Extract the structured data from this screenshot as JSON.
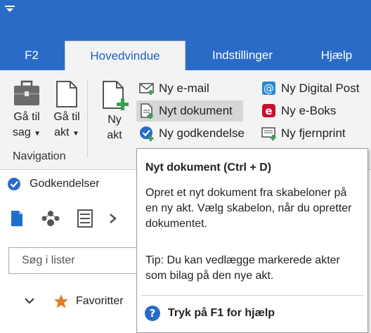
{
  "colors": {
    "accent": "#2a6bc7",
    "ribbon_bg": "#f3f3f3",
    "highlight": "#d6d6d6"
  },
  "tabs": [
    {
      "label": "F2"
    },
    {
      "label": "Hovedvindue"
    },
    {
      "label": "Indstillinger"
    },
    {
      "label": "Hjælp"
    }
  ],
  "ribbon": {
    "goto_case": {
      "line1": "Gå til",
      "line2": "sag"
    },
    "goto_record": {
      "line1": "Gå til",
      "line2": "akt"
    },
    "group_navigation": "Navigation",
    "new_record": {
      "line1": "Ny",
      "line2": "akt"
    },
    "new_email": "Ny e-mail",
    "new_document": "Nyt dokument",
    "new_approval": "Ny godkendelse",
    "new_digital_post": "Ny Digital Post",
    "new_eboks": "Ny e-Boks",
    "new_remote_print": "Ny fjernprint"
  },
  "pane": {
    "title": "Godkendelser",
    "search_placeholder": "Søg i lister",
    "favorites": "Favoritter"
  },
  "tooltip": {
    "title": "Nyt dokument (Ctrl + D)",
    "body": "Opret et nyt dokument fra skabeloner på en ny akt. Vælg skabelon, når du opretter dokumentet.",
    "tip": "Tip: Du kan vedlægge markerede akter som bilag på den nye akt.",
    "help": "Tryk på F1 for hjælp"
  }
}
